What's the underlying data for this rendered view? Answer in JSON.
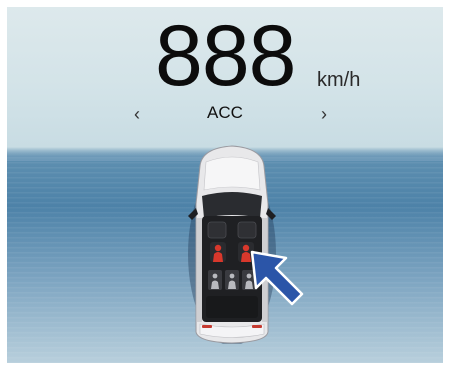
{
  "cluster": {
    "speed_value": "888",
    "speed_unit": "km/h",
    "drive_mode": "ACC",
    "prev_icon": "chevron-left-icon",
    "next_icon": "chevron-right-icon"
  },
  "vehicle": {
    "view": "top-down",
    "highlighted_seats": [
      "rear-left",
      "rear-right"
    ],
    "highlight_color": "#d8382c",
    "pointer_icon": "arrow-pointer-icon",
    "pointer_color": "#2b55a8"
  }
}
